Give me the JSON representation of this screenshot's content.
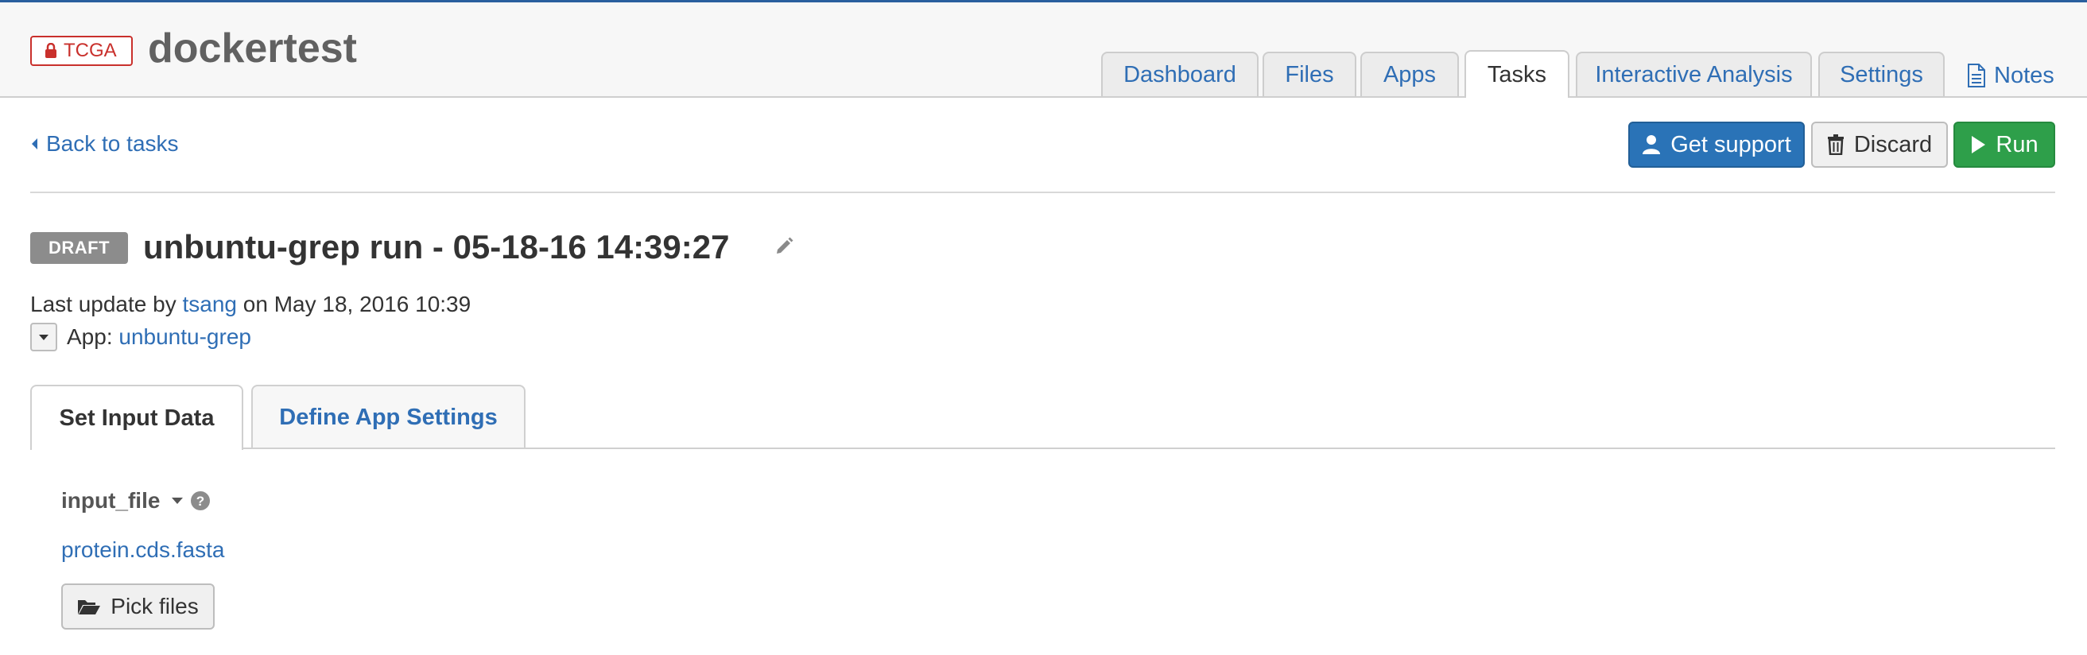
{
  "header": {
    "badge": "TCGA",
    "project_title": "dockertest",
    "tabs": [
      {
        "label": "Dashboard"
      },
      {
        "label": "Files"
      },
      {
        "label": "Apps"
      },
      {
        "label": "Tasks",
        "active": true
      },
      {
        "label": "Interactive Analysis"
      },
      {
        "label": "Settings"
      }
    ],
    "notes_label": "Notes"
  },
  "toolbar": {
    "back_label": "Back to tasks",
    "support_label": "Get support",
    "discard_label": "Discard",
    "run_label": "Run"
  },
  "task": {
    "status": "DRAFT",
    "title": "unbuntu-grep run - 05-18-16 14:39:27",
    "update_prefix": "Last update by",
    "user": "tsang",
    "update_suffix": "on May 18, 2016 10:39",
    "app_label": "App:",
    "app_name": "unbuntu-grep"
  },
  "subtabs": {
    "input": "Set Input Data",
    "settings": "Define App Settings"
  },
  "input": {
    "field_name": "input_file",
    "file_name": "protein.cds.fasta",
    "pick_label": "Pick files"
  },
  "colors": {
    "accent": "#2f6eb5",
    "danger": "#c9302c",
    "success": "#2e9f4a",
    "primary_button": "#2a73b7"
  }
}
